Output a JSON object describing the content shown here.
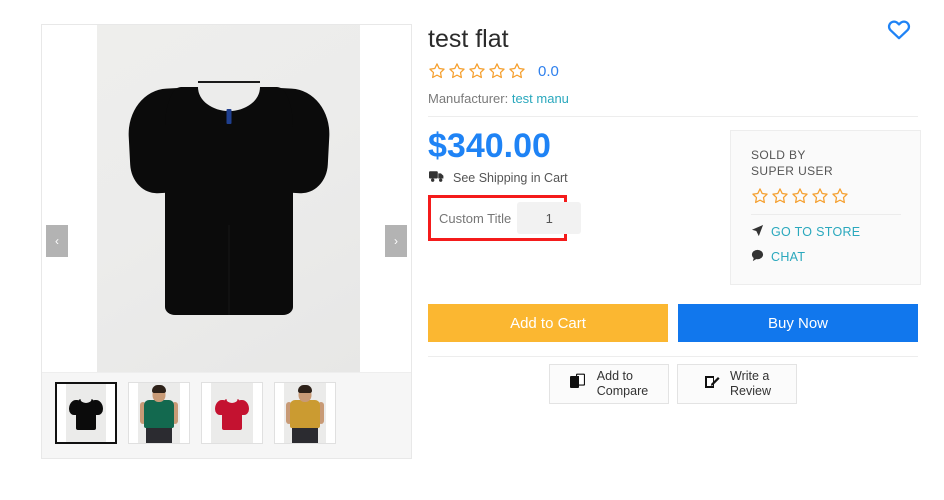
{
  "gallery": {
    "prev_arrow": "‹",
    "next_arrow": "›",
    "selected_index": 0,
    "thumbnails": [
      {
        "name": "black-tshirt-flat",
        "kind": "flat",
        "color": "#0b0b0b",
        "selected": true
      },
      {
        "name": "green-tshirt-model",
        "kind": "model",
        "color": "#13694f",
        "selected": false
      },
      {
        "name": "red-tshirt-flat",
        "kind": "flat",
        "color": "#c41230",
        "selected": false
      },
      {
        "name": "mustard-tshirt-model",
        "kind": "model",
        "color": "#cb9b31",
        "selected": false
      }
    ],
    "main_image_alt": "black t-shirt flat lay"
  },
  "product": {
    "title": "test flat",
    "rating_value": "0.0",
    "rating_stars": 0,
    "manufacturer_label": "Manufacturer:",
    "manufacturer_name": "test manu",
    "price": "$340.00",
    "shipping_text": "See Shipping in Cart",
    "custom_title_label": "Custom Title",
    "quantity_value": "1"
  },
  "seller": {
    "sold_by_line1": "SOLD BY",
    "sold_by_line2": "SUPER USER",
    "rating_stars": 0,
    "go_to_store": "GO TO STORE",
    "chat": "CHAT"
  },
  "actions": {
    "add_to_cart": "Add to Cart",
    "buy_now": "Buy Now",
    "add_to_compare": "Add to\nCompare",
    "add_to_compare_line1": "Add to",
    "add_to_compare_line2": "Compare",
    "write_review_line1": "Write a",
    "write_review_line2": "Review"
  },
  "colors": {
    "price_blue": "#1f83f5",
    "buy_now_blue": "#1177ed",
    "cart_yellow": "#fbb731",
    "star_orange": "#f5a030",
    "link_teal": "#2aa8bd",
    "highlight_red": "#f41b1b",
    "wishlist_blue": "#1f83f5"
  },
  "misc": {
    "top_sliver": "···"
  }
}
